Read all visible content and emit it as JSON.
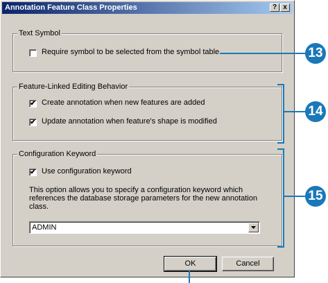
{
  "window": {
    "title": "Annotation Feature Class Properties",
    "help_glyph": "?",
    "close_glyph": "x"
  },
  "text_symbol": {
    "legend": "Text Symbol",
    "require_symbol_label": "Require symbol to be selected from the symbol table",
    "require_symbol_checked": false
  },
  "feature_linked": {
    "legend": "Feature-Linked Editing Behavior",
    "create_label": "Create annotation when new features are added",
    "create_checked": true,
    "update_label": "Update annotation when feature's shape is modified",
    "update_checked": true
  },
  "config_keyword": {
    "legend": "Configuration Keyword",
    "use_label": "Use configuration keyword",
    "use_checked": true,
    "description": "This option allows you to specify a configuration keyword which references the database storage parameters for the new annotation class.",
    "selected_value": "ADMIN"
  },
  "buttons": {
    "ok": "OK",
    "cancel": "Cancel"
  },
  "callouts": {
    "c13": "13",
    "c14": "14",
    "c15": "15",
    "color": "#1a78b8"
  },
  "check_glyph": "✔"
}
